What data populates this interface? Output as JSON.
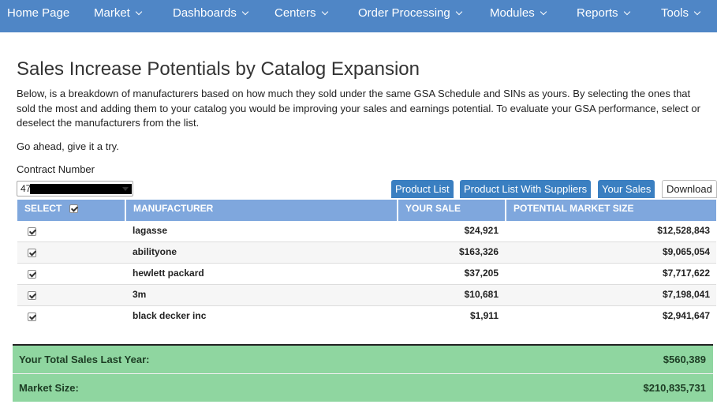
{
  "nav": {
    "items": [
      {
        "label": "Home Page",
        "dropdown": false
      },
      {
        "label": "Market",
        "dropdown": true
      },
      {
        "label": "Dashboards",
        "dropdown": true
      },
      {
        "label": "Centers",
        "dropdown": true
      },
      {
        "label": "Order Processing",
        "dropdown": true
      },
      {
        "label": "Modules",
        "dropdown": true
      },
      {
        "label": "Reports",
        "dropdown": true
      },
      {
        "label": "Tools",
        "dropdown": true
      }
    ]
  },
  "page": {
    "title": "Sales Increase Potentials by Catalog Expansion",
    "intro": "Below, is a breakdown of manufacturers based on how much they sold under the same GSA Schedule and SINs as yours. By selecting the ones that sold the most and adding them to your catalog you would be improving your sales and earnings potential. To evaluate your GSA performance, select or deselect the manufacturers from the list.",
    "try_text": "Go ahead, give it a try."
  },
  "contract": {
    "label": "Contract Number",
    "value": "47"
  },
  "buttons": {
    "product_list": "Product List",
    "product_list_suppliers": "Product List With Suppliers",
    "your_sales": "Your Sales",
    "download": "Download"
  },
  "table": {
    "headers": {
      "select": "SELECT",
      "manufacturer": "MANUFACTURER",
      "your_sale": "YOUR SALE",
      "potential": "POTENTIAL MARKET SIZE"
    },
    "rows": [
      {
        "manufacturer": "lagasse",
        "your_sale": "$24,921",
        "potential": "$12,528,843",
        "checked": true
      },
      {
        "manufacturer": "abilityone",
        "your_sale": "$163,326",
        "potential": "$9,065,054",
        "checked": true
      },
      {
        "manufacturer": "hewlett packard",
        "your_sale": "$37,205",
        "potential": "$7,717,622",
        "checked": true
      },
      {
        "manufacturer": "3m",
        "your_sale": "$10,681",
        "potential": "$7,198,041",
        "checked": true
      },
      {
        "manufacturer": "black decker inc",
        "your_sale": "$1,911",
        "potential": "$2,941,647",
        "checked": true
      }
    ]
  },
  "totals": {
    "last_year_label": "Your Total Sales Last Year:",
    "last_year_value": "$560,389",
    "market_label": "Market Size:",
    "market_value": "$210,835,731"
  },
  "colors": {
    "nav": "#4f86c6",
    "header": "#7fa7dd",
    "button": "#3a7fc1",
    "totals": "#8fd6a0"
  }
}
